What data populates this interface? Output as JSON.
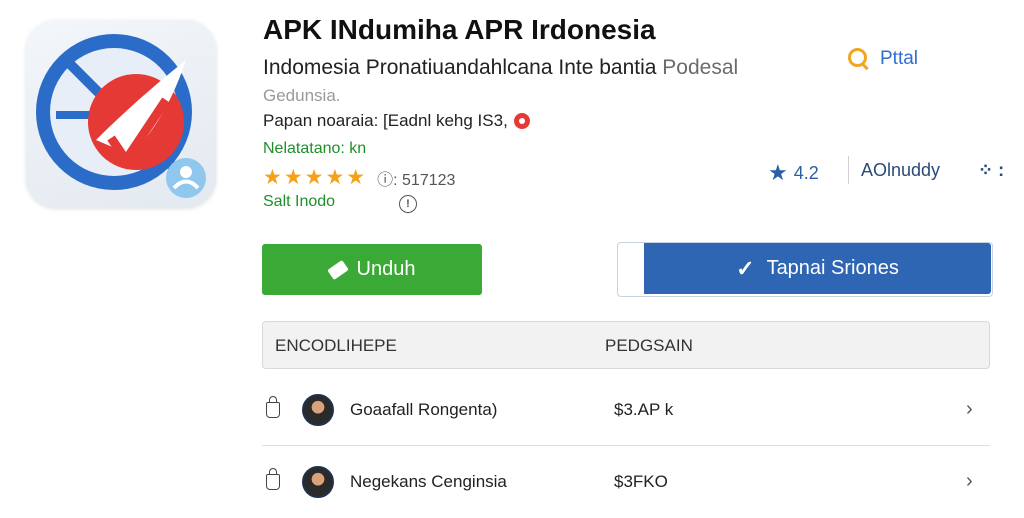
{
  "app": {
    "title": "APK INdumiha APR Irdonesia",
    "subtitle_main": "Indomesia Pronatiuandahlcana Inte bantia ",
    "subtitle_muted": "Podesal",
    "subtitle2": "Gedunsia.",
    "publisher_label": "Papan noaraia: [Eadnl kehg IS3,",
    "green_line1": "Nelatatano: kn",
    "stars_text": "★★★★★",
    "count": "ⓘ: 517123",
    "green_line2": "Salt Inodo"
  },
  "top_right": {
    "search_label": "Pttal",
    "rating": "4.2",
    "author": "AOlnuddy",
    "more": "⁘ :"
  },
  "buttons": {
    "download": "Unduh",
    "secondary": "Tapnai Sriones"
  },
  "table": {
    "headers": [
      "ENCODLIHEPE",
      "PEDGSAIN"
    ],
    "rows": [
      {
        "name": "Goaafall Rongenta)",
        "price": "$3.AP k"
      },
      {
        "name": "Negekans Cenginsia",
        "price": "$3FKO"
      }
    ]
  },
  "colors": {
    "green": "#3aa935",
    "blue": "#2e66b3",
    "star": "#f4a21b"
  }
}
